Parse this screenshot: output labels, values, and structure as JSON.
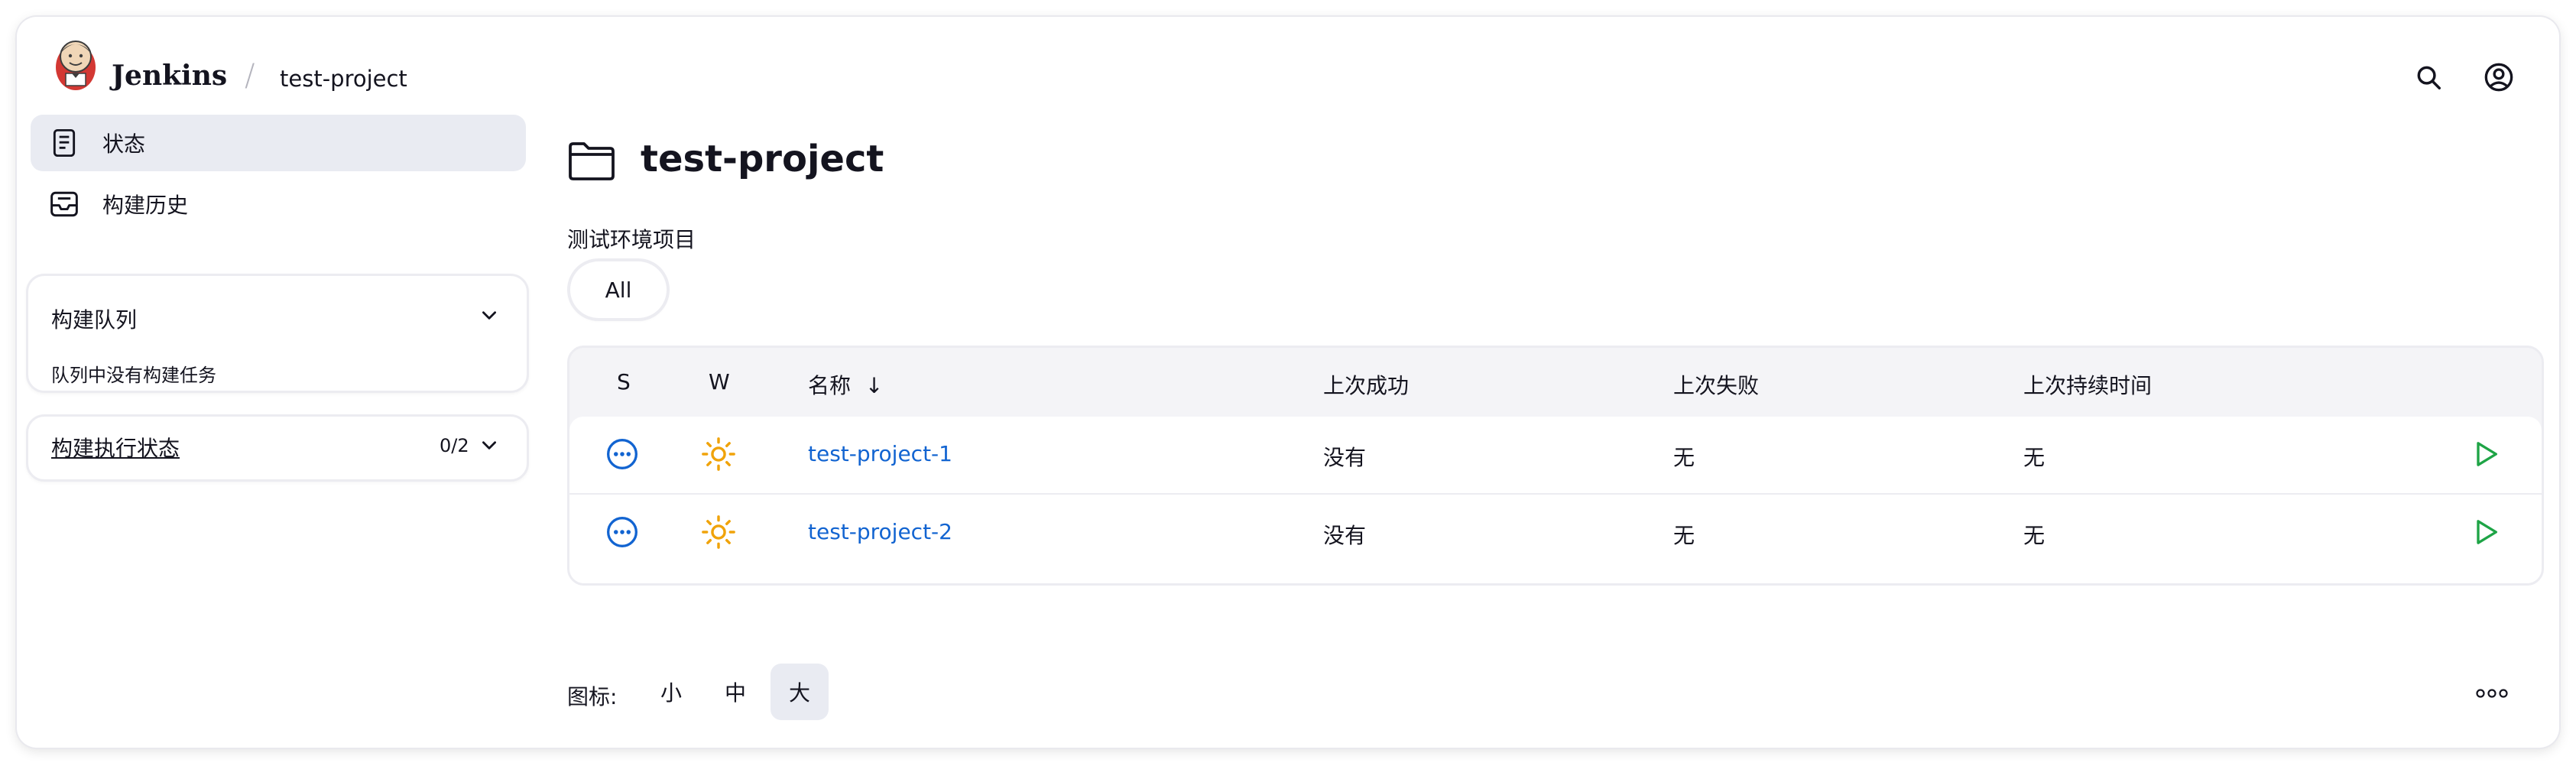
{
  "header": {
    "brand": "Jenkins",
    "breadcrumb_sep": "/",
    "breadcrumb": "test-project",
    "logo_icon": "jenkins-butler-logo",
    "search_icon": "search-icon",
    "user_icon": "user-circle-icon"
  },
  "sidebar": {
    "items": [
      {
        "label": "状态",
        "icon": "document-icon",
        "active": true
      },
      {
        "label": "构建历史",
        "icon": "inbox-icon",
        "active": false
      }
    ],
    "build_queue": {
      "title": "构建队列",
      "empty_text": "队列中没有构建任务"
    },
    "executors": {
      "title": "构建执行状态",
      "count": "0/2"
    }
  },
  "main": {
    "title": "test-project",
    "description": "测试环境项目",
    "tabs": [
      "All"
    ],
    "table": {
      "columns": [
        "S",
        "W",
        "名称",
        "上次成功",
        "上次失败",
        "上次持续时间"
      ],
      "sort_indicator": "↓",
      "rows": [
        {
          "name": "test-project-1",
          "last_success": "没有",
          "last_failure": "无",
          "last_duration": "无",
          "status_icon": "not-built-icon",
          "weather_icon": "sunny-icon"
        },
        {
          "name": "test-project-2",
          "last_success": "没有",
          "last_failure": "无",
          "last_duration": "无",
          "status_icon": "not-built-icon",
          "weather_icon": "sunny-icon"
        }
      ]
    },
    "icon_size": {
      "label": "图标:",
      "options": [
        "小",
        "中",
        "大"
      ],
      "selected": "大"
    }
  },
  "colors": {
    "accent_link": "#1264d1",
    "build_green": "#1ea446",
    "weather_orange": "#f0a30a",
    "active_bg": "#e9ebf2"
  }
}
